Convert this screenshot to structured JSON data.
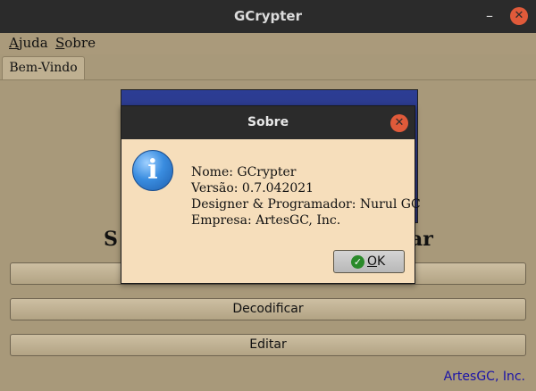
{
  "window": {
    "title": "GCrypter",
    "minimize_glyph": "–",
    "close_glyph": "✕"
  },
  "menubar": {
    "items": [
      {
        "label": "Ajuda",
        "mnemonic": "A",
        "rest": "juda"
      },
      {
        "label": "Sobre",
        "mnemonic": "S",
        "rest": "obre"
      }
    ]
  },
  "tabs": [
    {
      "label": "Bem-Vindo",
      "selected": true
    }
  ],
  "main": {
    "heading_left": "S",
    "heading_right": "ar",
    "buttons": [
      {
        "label": ""
      },
      {
        "label": "Decodificar"
      },
      {
        "label": "Editar"
      }
    ],
    "footer_link": "ArtesGC, Inc."
  },
  "dialog": {
    "title": "Sobre",
    "close_glyph": "✕",
    "icon": "info-icon",
    "icon_glyph": "i",
    "lines": [
      "Nome: GCrypter",
      "Versão: 0.7.042021",
      "Designer & Programador: Nurul GC",
      "Empresa: ArtesGC, Inc."
    ],
    "ok_button": {
      "mnemonic": "O",
      "rest": "K",
      "check_glyph": "✓"
    }
  },
  "colors": {
    "titlebar": "#2b2b2b",
    "window_bg": "#a8997a",
    "dialog_bg": "#f6debb",
    "close_button": "#e05a3a",
    "link": "#1a12a8"
  }
}
